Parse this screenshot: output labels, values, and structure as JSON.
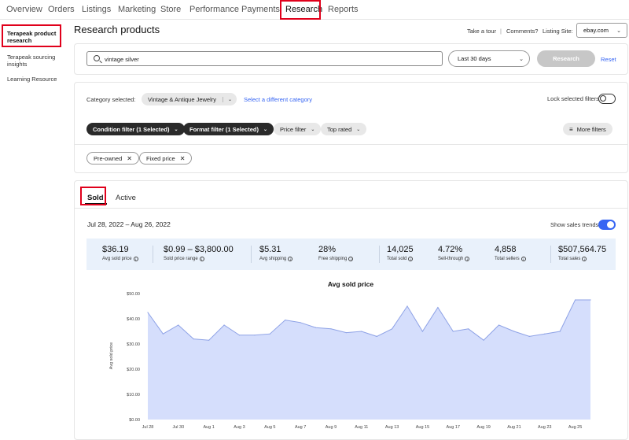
{
  "topnav": {
    "tabs": [
      "Overview",
      "Orders",
      "Listings",
      "Marketing",
      "Store",
      "Performance",
      "Payments",
      "Research",
      "Reports"
    ],
    "active": "Research"
  },
  "sidebar": {
    "items": [
      "Terapeak product research",
      "Terapeak sourcing insights",
      "Learning Resource"
    ]
  },
  "header": {
    "title": "Research products",
    "take_tour": "Take a tour",
    "separator": "|",
    "comments": "Comments?",
    "listing_site_label": "Listing Site:",
    "listing_site_value": "ebay.com"
  },
  "search": {
    "value": "vintage silver",
    "date_range": "Last 30 days",
    "research_button": "Research",
    "reset": "Reset"
  },
  "category": {
    "label": "Category selected:",
    "value": "Vintage & Antique Jewelry",
    "change_link": "Select a different category",
    "lock_label": "Lock selected filters"
  },
  "filters": {
    "condition": "Condition filter (1 Selected)",
    "format": "Format filter (1 Selected)",
    "price": "Price filter",
    "top_rated": "Top rated",
    "more": "More filters",
    "applied": [
      "Pre-owned",
      "Fixed price"
    ]
  },
  "results": {
    "tabs": [
      "Sold",
      "Active"
    ],
    "active_tab": "Sold",
    "date_range": "Jul 28, 2022 – Aug 26, 2022",
    "trend_toggle_label": "Show sales trends"
  },
  "stats": [
    {
      "value": "$36.19",
      "label": "Avg sold price"
    },
    {
      "value": "$0.99 – $3,800.00",
      "label": "Sold price range"
    },
    {
      "value": "$5.31",
      "label": "Avg shipping"
    },
    {
      "value": "28%",
      "label": "Free shipping"
    },
    {
      "value": "14,025",
      "label": "Total sold"
    },
    {
      "value": "4.72%",
      "label": "Sell-through"
    },
    {
      "value": "4,858",
      "label": "Total sellers"
    },
    {
      "value": "$507,564.75",
      "label": "Total sales"
    }
  ],
  "chart_data": {
    "type": "area",
    "title": "Avg sold price",
    "ylabel": "Avg sold price",
    "xlabel": "",
    "ylim": [
      0,
      50
    ],
    "yticks": [
      "$0.00",
      "$10.00",
      "$20.00",
      "$30.00",
      "$40.00",
      "$50.00"
    ],
    "xtick_labels": [
      "Jul 28",
      "Jul 30",
      "Aug 1",
      "Aug 3",
      "Aug 5",
      "Aug 7",
      "Aug 9",
      "Aug 11",
      "Aug 13",
      "Aug 15",
      "Aug 17",
      "Aug 19",
      "Aug 21",
      "Aug 23",
      "Aug 25"
    ],
    "x": [
      "Jul 28",
      "Jul 29",
      "Jul 30",
      "Jul 31",
      "Aug 1",
      "Aug 2",
      "Aug 3",
      "Aug 4",
      "Aug 5",
      "Aug 6",
      "Aug 7",
      "Aug 8",
      "Aug 9",
      "Aug 10",
      "Aug 11",
      "Aug 12",
      "Aug 13",
      "Aug 14",
      "Aug 15",
      "Aug 16",
      "Aug 17",
      "Aug 18",
      "Aug 19",
      "Aug 20",
      "Aug 21",
      "Aug 22",
      "Aug 23",
      "Aug 24",
      "Aug 25",
      "Aug 26"
    ],
    "values": [
      42.5,
      34,
      37.5,
      32,
      31.5,
      37.5,
      33.5,
      33.5,
      34,
      39.5,
      38.5,
      36.5,
      36,
      34.5,
      35,
      33,
      36,
      45,
      35,
      44.5,
      35,
      36,
      31.5,
      37.5,
      35,
      33,
      34,
      35,
      47.5,
      47.5
    ],
    "grid": false,
    "colors": {
      "fill": "#d5defc",
      "line": "#8ea2e6"
    }
  }
}
